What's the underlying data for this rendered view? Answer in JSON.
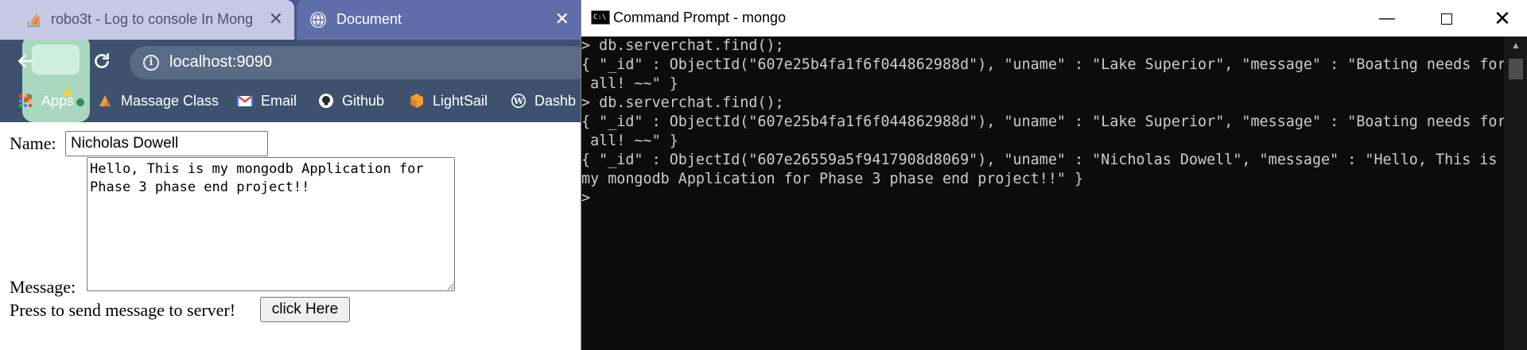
{
  "browser": {
    "tabs": [
      {
        "title": "robo3t - Log to console In Mong",
        "close": "✕"
      },
      {
        "title": "Document",
        "close": "✕"
      }
    ],
    "url": "localhost:9090",
    "bookmarks": [
      "Apps",
      "Massage Class",
      "Email",
      "Github",
      "LightSail",
      "Dashb"
    ],
    "page": {
      "name_label": "Name:",
      "name_value": "Nicholas Dowell",
      "message_value": "Hello, This is my mongodb Application for Phase 3 phase end project!!",
      "message_label": "Message:",
      "send_label": "Press to send message to server!",
      "send_button": "click Here"
    }
  },
  "cmd": {
    "title": "Command Prompt - mongo",
    "controls": {
      "minimize": "—",
      "close": "✕"
    },
    "lines": [
      "> db.serverchat.find();",
      "{ \"_id\" : ObjectId(\"607e25b4fa1f6f044862988d\"), \"uname\" : \"Lake Superior\", \"message\" : \"Boating needs for",
      " all! ~~\" }",
      "> db.serverchat.find();",
      "{ \"_id\" : ObjectId(\"607e25b4fa1f6f044862988d\"), \"uname\" : \"Lake Superior\", \"message\" : \"Boating needs for",
      " all! ~~\" }",
      "{ \"_id\" : ObjectId(\"607e26559a5f9417908d8069\"), \"uname\" : \"Nicholas Dowell\", \"message\" : \"Hello, This is",
      "my mongodb Application for Phase 3 phase end project!!\" }",
      ">"
    ]
  },
  "colors": {
    "tab_strip": "#4a568d",
    "active_tab": "#5f6da8",
    "inactive_tab": "#c5c9e4",
    "toolbar": "#3e5270",
    "console_bg": "#0c0c0c",
    "console_text": "#cccccc"
  },
  "icons": [
    "stackoverflow-icon",
    "globe-icon",
    "back-arrow-icon",
    "reload-icon",
    "info-icon",
    "apps-grid-icon",
    "massage-icon",
    "gmail-icon",
    "github-icon",
    "lightsail-icon",
    "wordpress-icon",
    "cmd-app-icon"
  ]
}
